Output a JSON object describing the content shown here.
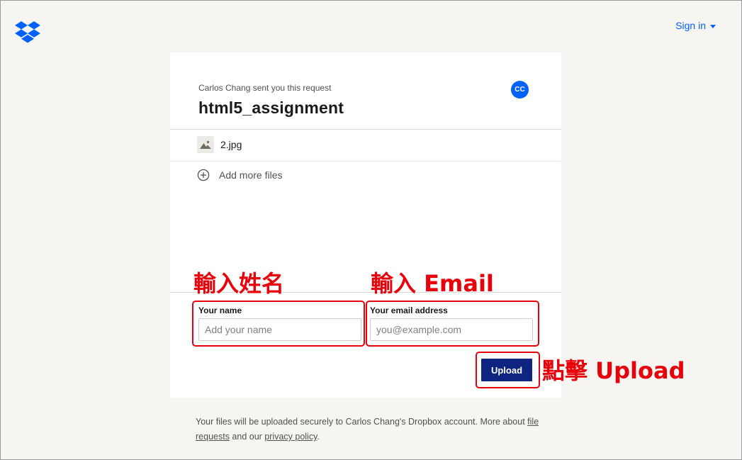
{
  "header": {
    "logo_icon": "dropbox-logo-icon",
    "signin_label": "Sign in",
    "signin_icon": "caret-down-icon",
    "accent_color": "#0061fe"
  },
  "request": {
    "sender_text": "Carlos Chang sent you this request",
    "title": "html5_assignment",
    "avatar_initials": "CC"
  },
  "files": [
    {
      "name": "2.jpg",
      "icon": "image-icon"
    }
  ],
  "add_files": {
    "label": "Add more files",
    "icon": "plus-circle-icon"
  },
  "form": {
    "name_label": "Your name",
    "name_placeholder": "Add your name",
    "name_value": "",
    "email_label": "Your email address",
    "email_placeholder": "you@example.com",
    "email_value": "",
    "upload_label": "Upload",
    "button_color": "#0d2481"
  },
  "annotations": {
    "enter_name": "輸入姓名",
    "enter_email": "輸入 Email",
    "click_upload": "點擊 Upload",
    "color": "#e8000b"
  },
  "footer": {
    "text_before": "Your files will be uploaded securely to Carlos Chang's Dropbox account. More about ",
    "link_file_requests": "file requests",
    "text_middle": " and our ",
    "link_privacy": "privacy policy",
    "text_after": "."
  }
}
